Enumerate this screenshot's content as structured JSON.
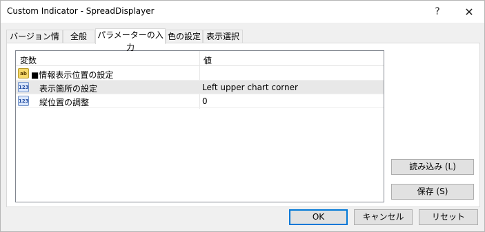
{
  "window": {
    "title": "Custom Indicator - SpreadDisplayer",
    "help_glyph": "?",
    "close_glyph": "✕"
  },
  "tabs": [
    {
      "label": "バージョン情報",
      "active": false
    },
    {
      "label": "全般",
      "active": false
    },
    {
      "label": "パラメーターの入力",
      "active": true
    },
    {
      "label": "色の設定",
      "active": false
    },
    {
      "label": "表示選択",
      "active": false
    }
  ],
  "grid": {
    "columns": {
      "variable": "変数",
      "value": "値"
    },
    "rows": [
      {
        "icon": "ab-string-icon",
        "icon_text": "ab",
        "name": "■情報表示位置の設定",
        "value": "",
        "selected": false
      },
      {
        "icon": "numeric-123-icon",
        "icon_text": "123",
        "name": "表示箇所の設定",
        "value": "Left upper chart corner",
        "selected": true
      },
      {
        "icon": "numeric-123-icon",
        "icon_text": "123",
        "name": "縦位置の調整",
        "value": "0",
        "selected": false
      }
    ]
  },
  "side_buttons": {
    "load": "読み込み (L)",
    "save": "保存 (S)"
  },
  "footer_buttons": {
    "ok": "OK",
    "cancel": "キャンセル",
    "reset": "リセット"
  },
  "colors": {
    "dialog_bg": "#f0f0f0",
    "selected_row": "#e8e8e8",
    "default_button_border": "#0078d7"
  }
}
